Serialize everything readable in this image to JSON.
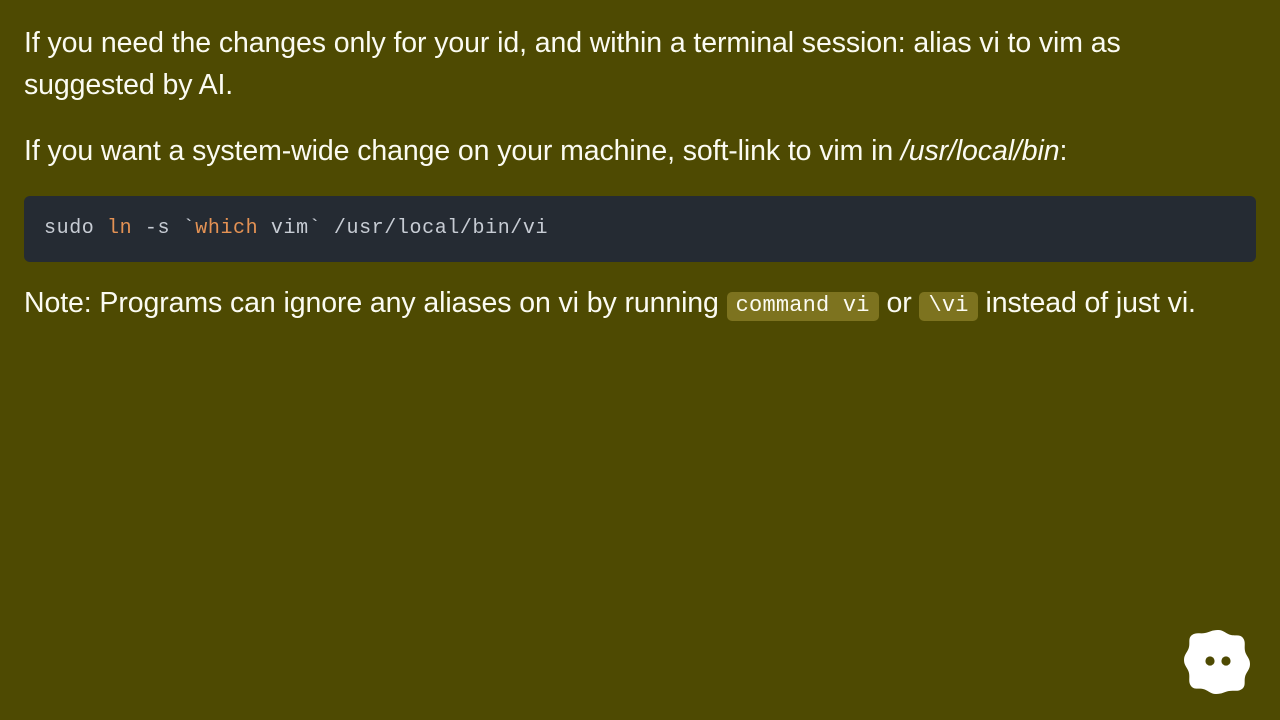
{
  "background_color": "#4e4a02",
  "text_color": "#fbfbf2",
  "paragraphs": {
    "p1": {
      "text": "If you need the changes only for your id, and within a terminal session: alias vi to vim as suggested by AI."
    },
    "p2": {
      "lead": "If you want a system-wide change on your machine, soft-link to vim in ",
      "path_italic": "/usr/local/bin",
      "trail": ":"
    },
    "note": {
      "lead": "Note: Programs can ignore any aliases on vi by running ",
      "code_1": "command vi",
      "middle": " or ",
      "code_2": "\\vi",
      "trail": " instead of just vi."
    }
  },
  "code_block": {
    "background_color": "#252b33",
    "default_color": "#c7ccd4",
    "keyword_color": "#e49254",
    "tokens": [
      {
        "text": "sudo ",
        "type": "plain"
      },
      {
        "text": "ln",
        "type": "cmd"
      },
      {
        "text": " -s `",
        "type": "plain"
      },
      {
        "text": "which",
        "type": "cmd"
      },
      {
        "text": " vim` /usr/local/bin/vi",
        "type": "plain"
      }
    ],
    "full_text": "sudo ln -s `which vim` /usr/local/bin/vi"
  },
  "inline_code_style": {
    "background_color": "#7d731f",
    "text_color": "#fbfbf2"
  },
  "indicator": {
    "name": "blob-dots-indicator",
    "blob_color": "#ffffff",
    "dot_color": "#4e4a02",
    "dot_count": 2
  }
}
